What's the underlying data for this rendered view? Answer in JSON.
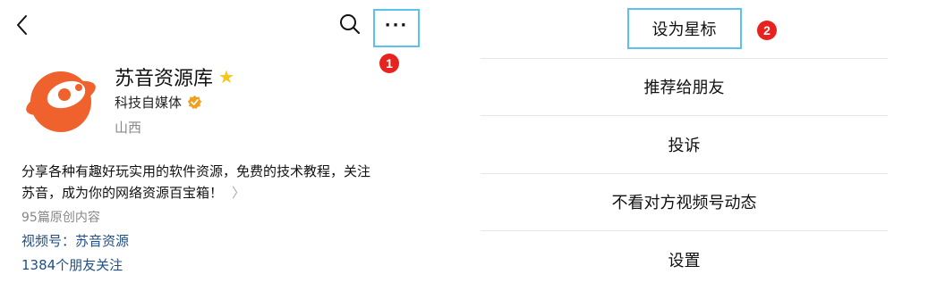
{
  "header": {
    "back_icon": "chevron-left-icon",
    "search_icon": "search-icon",
    "more_label": "···"
  },
  "annotations": {
    "step1": "1",
    "step2": "2"
  },
  "profile": {
    "name": "苏音资源库",
    "type": "科技自媒体",
    "location": "山西",
    "bio_line1": "分享各种有趣好玩实用的软件资源，免费的技术教程，关注",
    "bio_line2": "苏音，成为你的网络资源百宝箱！",
    "original_count": "95篇原创内容",
    "channel": "视频号：苏音资源",
    "friends": "1384个朋友关注"
  },
  "menu": {
    "items": [
      {
        "label": "设为星标"
      },
      {
        "label": "推荐给朋友"
      },
      {
        "label": "投诉"
      },
      {
        "label": "不看对方视频号动态"
      },
      {
        "label": "设置"
      }
    ]
  },
  "colors": {
    "highlight_border": "#5bc2ee",
    "badge": "#e8231f",
    "link": "#1f4f86",
    "avatar_orange": "#f0622d",
    "star": "#f5c518",
    "verified": "#f0a020"
  }
}
